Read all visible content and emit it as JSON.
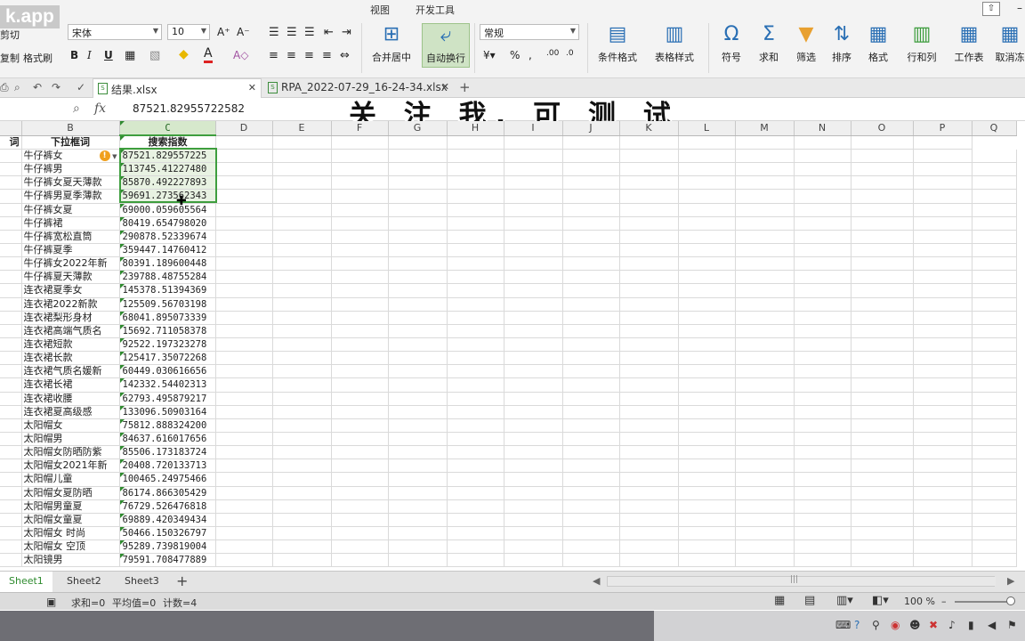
{
  "logo": "k.app",
  "menu": {
    "tabs": [
      "视图",
      "开发工具"
    ]
  },
  "ribbon": {
    "clipboard": {
      "cut": "剪切",
      "copy": "复制",
      "format_painter": "格式刷"
    },
    "font": {
      "name": "宋体",
      "size": "10"
    },
    "merge_center": "合并居中",
    "wrap_text": "自动换行",
    "number_format": "常规",
    "groups": [
      "条件格式",
      "表格样式",
      "符号",
      "求和",
      "筛选",
      "排序",
      "格式",
      "行和列",
      "工作表",
      "取消冻"
    ]
  },
  "tabs": [
    {
      "label": "结果.xlsx",
      "active": true
    },
    {
      "label": "RPA_2022-07-29_16-24-34.xlsx",
      "active": false
    }
  ],
  "formula_bar": {
    "fx": "fx",
    "value": "87521.82955722582"
  },
  "overlay_text": "关 注 我, 可 测 试",
  "columns": [
    "B",
    "C",
    "D",
    "E",
    "F",
    "G",
    "H",
    "I",
    "J",
    "K",
    "L",
    "M",
    "N",
    "O",
    "P",
    "Q"
  ],
  "first_col_partial": "词",
  "header_row": {
    "b": "下拉框词",
    "c": "搜索指数"
  },
  "rows": [
    [
      "牛仔裤女",
      "87521.829557225"
    ],
    [
      "牛仔裤男",
      "113745.41227480"
    ],
    [
      "牛仔裤女夏天薄款",
      "85870.492227893"
    ],
    [
      "牛仔裤男夏季薄款",
      "59691.273562343"
    ],
    [
      "牛仔裤女夏",
      "69000.059605564"
    ],
    [
      "牛仔裤裙",
      "80419.654798020"
    ],
    [
      "牛仔裤宽松直筒",
      "290878.52339674"
    ],
    [
      "牛仔裤夏季",
      "359447.14760412"
    ],
    [
      "牛仔裤女2022年新",
      "80391.189600448"
    ],
    [
      "牛仔裤夏天薄款",
      "239788.48755284"
    ],
    [
      "连衣裙夏季女",
      "145378.51394369"
    ],
    [
      "连衣裙2022新款",
      "125509.56703198"
    ],
    [
      "连衣裙梨形身材",
      "68041.895073339"
    ],
    [
      "连衣裙高端气质名",
      "15692.711058378"
    ],
    [
      "连衣裙短款",
      "92522.197323278"
    ],
    [
      "连衣裙长款",
      "125417.35072268"
    ],
    [
      "连衣裙气质名媛新",
      "60449.030616656"
    ],
    [
      "连衣裙长裙",
      "142332.54402313"
    ],
    [
      "连衣裙收腰",
      "62793.495879217"
    ],
    [
      "连衣裙夏高级感",
      "133096.50903164"
    ],
    [
      "太阳帽女",
      "75812.888324200"
    ],
    [
      "太阳帽男",
      "84637.616017656"
    ],
    [
      "太阳帽女防晒防紫",
      "85506.173183724"
    ],
    [
      "太阳帽女2021年新",
      "20408.720133713"
    ],
    [
      "太阳帽儿童",
      "100465.24975466"
    ],
    [
      "太阳帽女夏防晒",
      "86174.866305429"
    ],
    [
      "太阳帽男童夏",
      "76729.526476818"
    ],
    [
      "太阳帽女童夏",
      "69889.420349434"
    ],
    [
      "太阳帽女 时尚",
      "50466.150326797"
    ],
    [
      "太阳帽女 空顶",
      "95289.739819004"
    ],
    [
      "太阳镜男",
      "79591.708477889"
    ]
  ],
  "sheets": [
    "Sheet1",
    "Sheet2",
    "Sheet3"
  ],
  "status": {
    "sum": "求和=0",
    "avg": "平均值=0",
    "count": "计数=4",
    "zoom": "100 %"
  }
}
